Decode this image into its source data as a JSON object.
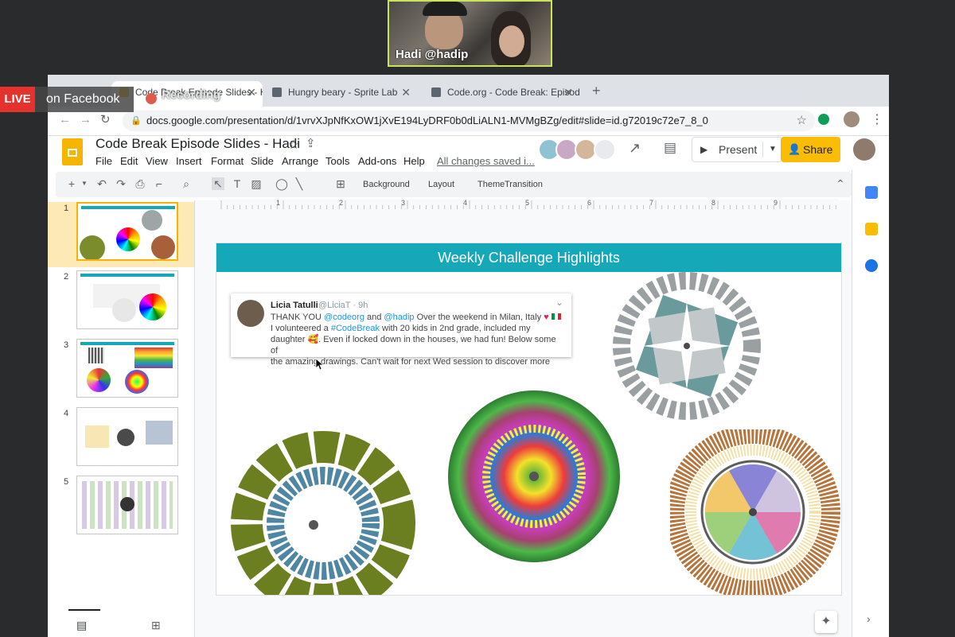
{
  "video": {
    "name": "Hadi @hadip"
  },
  "live": {
    "badge": "LIVE",
    "platform": "on Facebook",
    "recording": "Recording"
  },
  "browser": {
    "tabs": [
      {
        "label": "Code Break Episode Slides - Hadi",
        "active": true
      },
      {
        "label": "Hungry beary - Sprite Lab",
        "active": false
      },
      {
        "label": "Code.org - Code Break: Episode",
        "active": false
      }
    ],
    "new_tab": "+",
    "url": "docs.google.com/presentation/d/1vrvXJpNfKxOW1jXvE194LyDRF0b0dLiALN1-MVMgBZg/edit#slide=id.g72019c72e7_8_0"
  },
  "docs": {
    "title": "Code Break Episode Slides - Hadi",
    "menu": [
      "File",
      "Edit",
      "View",
      "Insert",
      "Format",
      "Slide",
      "Arrange",
      "Tools",
      "Add-ons",
      "Help"
    ],
    "saved_status": "All changes saved i...",
    "present_label": "Present",
    "share_label": "Share"
  },
  "toolbar": {
    "background": "Background",
    "layout": "Layout",
    "theme": "Theme",
    "transition": "Transition"
  },
  "filmstrip": {
    "slides": [
      {
        "num": "1",
        "selected": true
      },
      {
        "num": "2",
        "selected": false
      },
      {
        "num": "3",
        "selected": false
      },
      {
        "num": "4",
        "selected": false
      },
      {
        "num": "5",
        "selected": false
      }
    ]
  },
  "ruler": {
    "marks": [
      "1",
      "2",
      "3",
      "4",
      "5",
      "6",
      "7",
      "8",
      "9"
    ]
  },
  "slide": {
    "title": "Weekly Challenge Highlights",
    "tweet": {
      "author": "Licia Tatulli",
      "handle": "@LiciaT · 9h",
      "line1_a": "THANK YOU ",
      "line1_b": "@codeorg",
      "line1_c": " and ",
      "line1_d": "@hadip",
      "line1_e": " Over the weekend in Milan, Italy ",
      "line2_a": " I volunteered a ",
      "line2_b": "#CodeBreak",
      "line2_c": " with 20 kids in 2nd grade, included my",
      "line3": "daughter 🥰. Even if locked down in the houses, we had fun! Below some of",
      "line4": "the amazing drawings. Can't wait for next Wed session to discover more"
    }
  },
  "colors": {
    "accent": "#14a8b8",
    "share": "#fbbc04",
    "live": "#e5322d"
  }
}
